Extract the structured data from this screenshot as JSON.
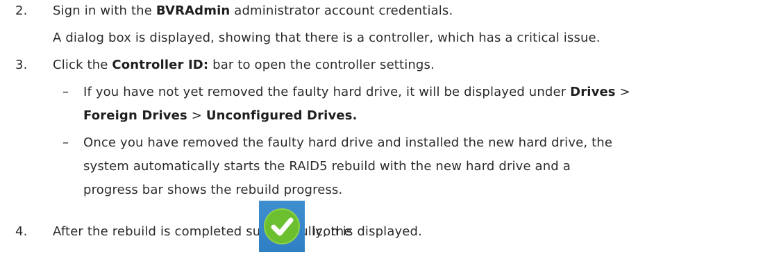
{
  "steps": [
    {
      "num": "2.",
      "line1_pre": "Sign in with the ",
      "line1_bold": "BVRAdmin",
      "line1_post": " administrator account credentials.",
      "line2": "A dialog box is displayed, showing that there is a controller, which has a critical issue."
    },
    {
      "num": "3.",
      "line1_pre": "Click the ",
      "line1_bold": "Controller ID:",
      "line1_post": " bar to open the controller settings."
    },
    {
      "num": "4.",
      "pre": "After the rebuild is completed successfully, the",
      "post": "icon is displayed."
    }
  ],
  "bullets": {
    "dash": "–",
    "b1_l1_pre": "If you have not yet removed the faulty hard drive, it will be displayed under ",
    "b1_l1_bold": "Drives",
    "b1_l1_sep": " >",
    "b1_l2_bold1": "Foreign Drives",
    "b1_l2_sep": " > ",
    "b1_l2_bold2": "Unconfigured Drives.",
    "b2_l1": "Once you have removed the faulty hard drive and installed the new hard drive, the",
    "b2_l2": "system automatically starts the RAID5 rebuild with the new hard drive and a",
    "b2_l3": "progress bar shows the rebuild progress."
  },
  "icons": {
    "success": "checkmark-icon",
    "success_bg": "#2f7fc4",
    "success_circle": "#6cbf2f"
  }
}
